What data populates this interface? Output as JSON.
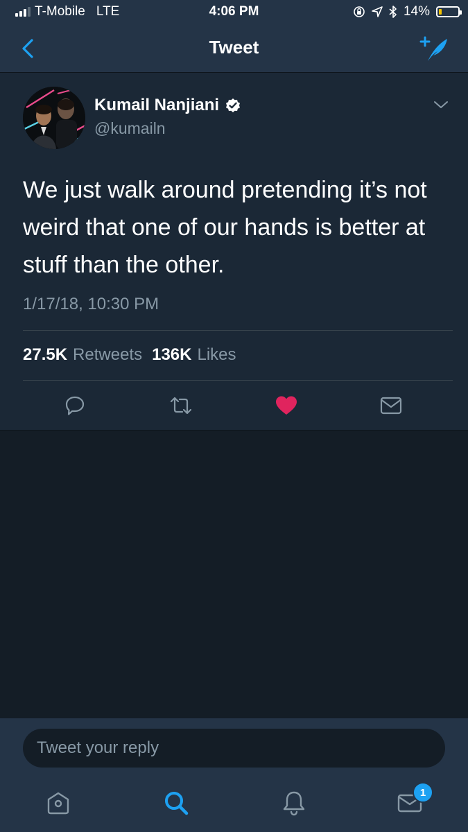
{
  "status_bar": {
    "carrier": "T-Mobile",
    "network": "LTE",
    "time": "4:06 PM",
    "battery_percent": "14%",
    "battery_level": 0.14,
    "battery_color": "#f5c400",
    "icons": [
      "signal-icon",
      "rotation-lock-icon",
      "location-icon",
      "bluetooth-icon",
      "battery-icon"
    ]
  },
  "navbar": {
    "title": "Tweet",
    "back_icon": "chevron-left-icon",
    "compose_icon": "compose-tweet-icon",
    "accent_color": "#1da1f2"
  },
  "tweet": {
    "author": {
      "display_name": "Kumail Nanjiani",
      "handle": "@kumailn",
      "verified": true
    },
    "text": "We just walk around pretending it’s not weird that one of our hands is better at stuff than the other.",
    "timestamp": "1/17/18, 10:30 PM",
    "stats": {
      "retweets_count": "27.5K",
      "retweets_label": "Retweets",
      "likes_count": "136K",
      "likes_label": "Likes"
    },
    "actions": [
      "reply-icon",
      "retweet-icon",
      "like-icon",
      "direct-message-icon"
    ],
    "liked": true,
    "like_color": "#e0245e"
  },
  "reply": {
    "placeholder": "Tweet your reply",
    "value": ""
  },
  "tabbar": {
    "tabs": [
      "home-icon",
      "search-icon",
      "notifications-icon",
      "messages-icon"
    ],
    "active": "search-icon",
    "messages_badge": "1"
  }
}
